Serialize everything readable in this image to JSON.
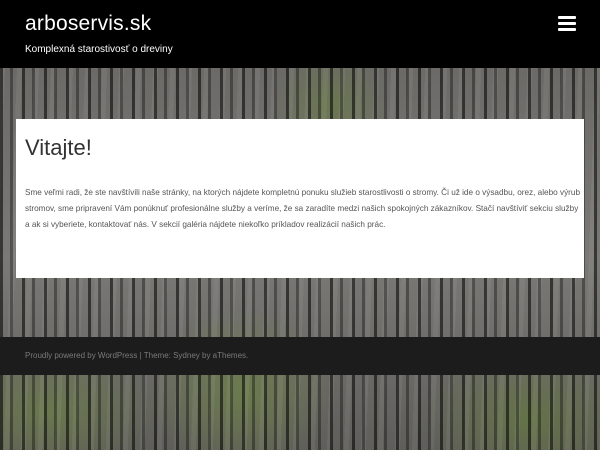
{
  "header": {
    "site_title": "arboservis.sk",
    "tagline": "Komplexná starostivosť o dreviny",
    "menu_icon": "hamburger-menu-icon"
  },
  "main": {
    "title": "Vitajte!",
    "text": "Sme veľmi radi, že ste navštívili naše stránky, na ktorých nájdete kompletnú ponuku služieb starostlivosti o stromy. Či už ide o výsadbu, orez, alebo výrub stromov, sme pripravení Vám ponúknuť profesionálne služby a veríme, že sa zaradíte medzi našich spokojných zákazníkov. Stačí navštíviť sekciu služby a ak si vyberiete, kontaktovať nás. V sekcií galéria nájdete niekoľko príkladov realizácií našich prác."
  },
  "footer": {
    "powered_link": "Proudly powered by WordPress",
    "separator": " | ",
    "theme_text": "Theme: Sydney by aThemes."
  },
  "colors": {
    "header_bg": "#000000",
    "footer_bg": "#1c1c1c",
    "card_bg": "#ffffff"
  }
}
